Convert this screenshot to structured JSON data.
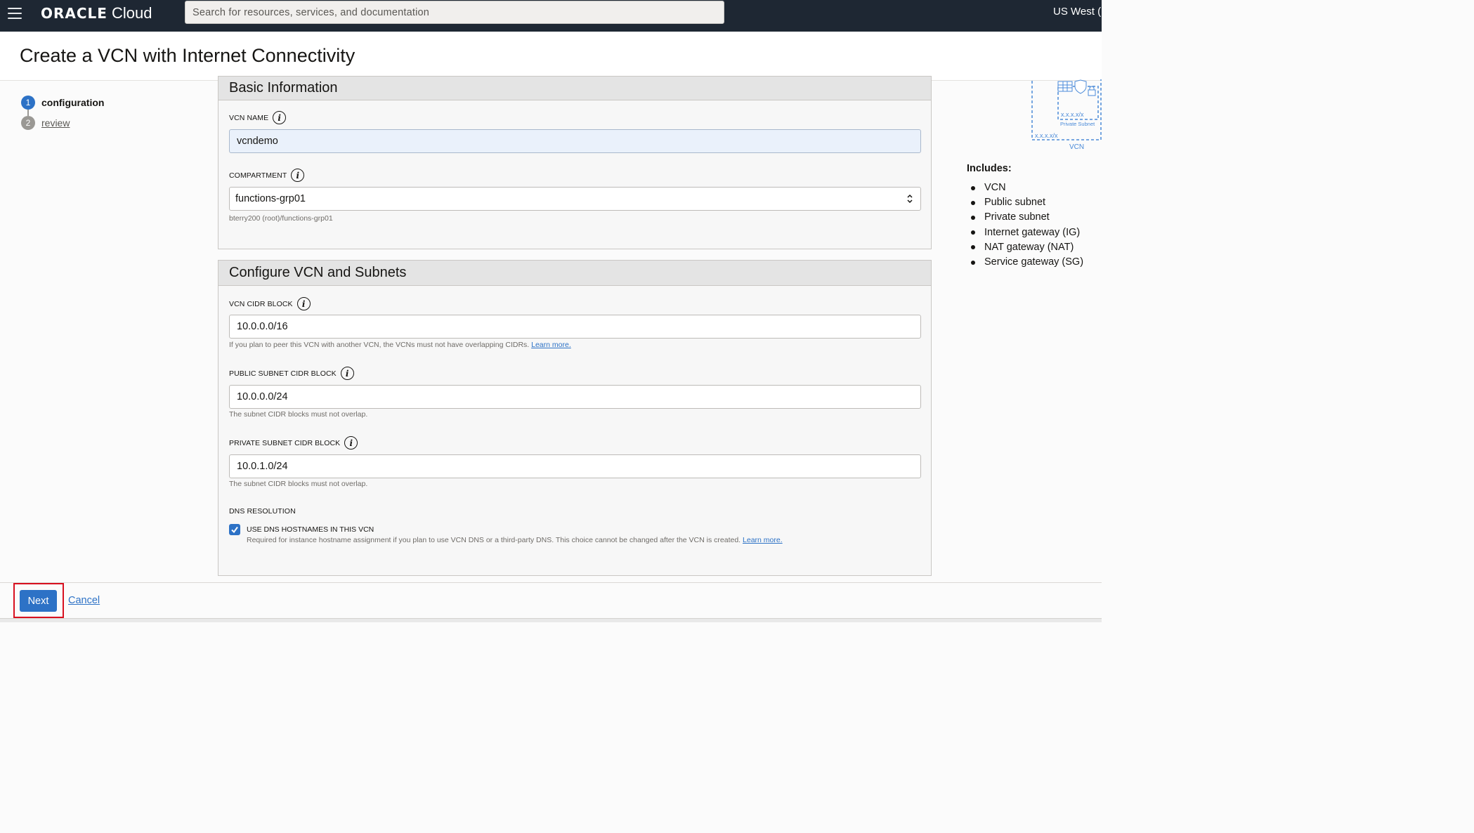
{
  "topbar": {
    "logo_oracle": "ORACLE",
    "logo_cloud": "Cloud",
    "search_placeholder": "Search for resources, services, and documentation",
    "region": "US West ("
  },
  "page": {
    "title": "Create a VCN with Internet Connectivity"
  },
  "steps": [
    {
      "number": "1",
      "label": "configuration",
      "state": "current"
    },
    {
      "number": "2",
      "label": "review",
      "state": "pending"
    }
  ],
  "basic_info": {
    "heading": "Basic Information",
    "vcn_name_label": "VCN NAME",
    "vcn_name_value": "vcndemo",
    "compartment_label": "COMPARTMENT",
    "compartment_value": "functions-grp01",
    "compartment_path": "bterry200 (root)/functions-grp01"
  },
  "configure": {
    "heading": "Configure VCN and Subnets",
    "vcn_cidr_label": "VCN CIDR BLOCK",
    "vcn_cidr_value": "10.0.0.0/16",
    "vcn_cidr_help": "If you plan to peer this VCN with another VCN, the VCNs must not have overlapping CIDRs.",
    "learn_more": "Learn more.",
    "public_cidr_label": "PUBLIC SUBNET CIDR BLOCK",
    "public_cidr_value": "10.0.0.0/24",
    "private_cidr_label": "PRIVATE SUBNET CIDR BLOCK",
    "private_cidr_value": "10.0.1.0/24",
    "subnet_help": "The subnet CIDR blocks must not overlap.",
    "dns_label": "DNS RESOLUTION",
    "dns_checkbox_label": "USE DNS HOSTNAMES IN THIS VCN",
    "dns_checked": true,
    "dns_help": "Required for instance hostname assignment if you plan to use VCN DNS or a third-party DNS. This choice cannot be changed after the VCN is created."
  },
  "diagram": {
    "subnet_cidr": "x.x.x.x/x",
    "subnet_label": "Private Subnet",
    "vcn_cidr": "x.x.x.x/x",
    "vcn_label": "VCN"
  },
  "includes": {
    "title": "Includes:",
    "items": [
      "VCN",
      "Public subnet",
      "Private subnet",
      "Internet gateway (IG)",
      "NAT gateway (NAT)",
      "Service gateway (SG)"
    ]
  },
  "footer": {
    "next_label": "Next",
    "cancel_label": "Cancel"
  },
  "colors": {
    "topbar": "#1e2733",
    "accent": "#2d72c6",
    "highlight": "#d8101f"
  }
}
